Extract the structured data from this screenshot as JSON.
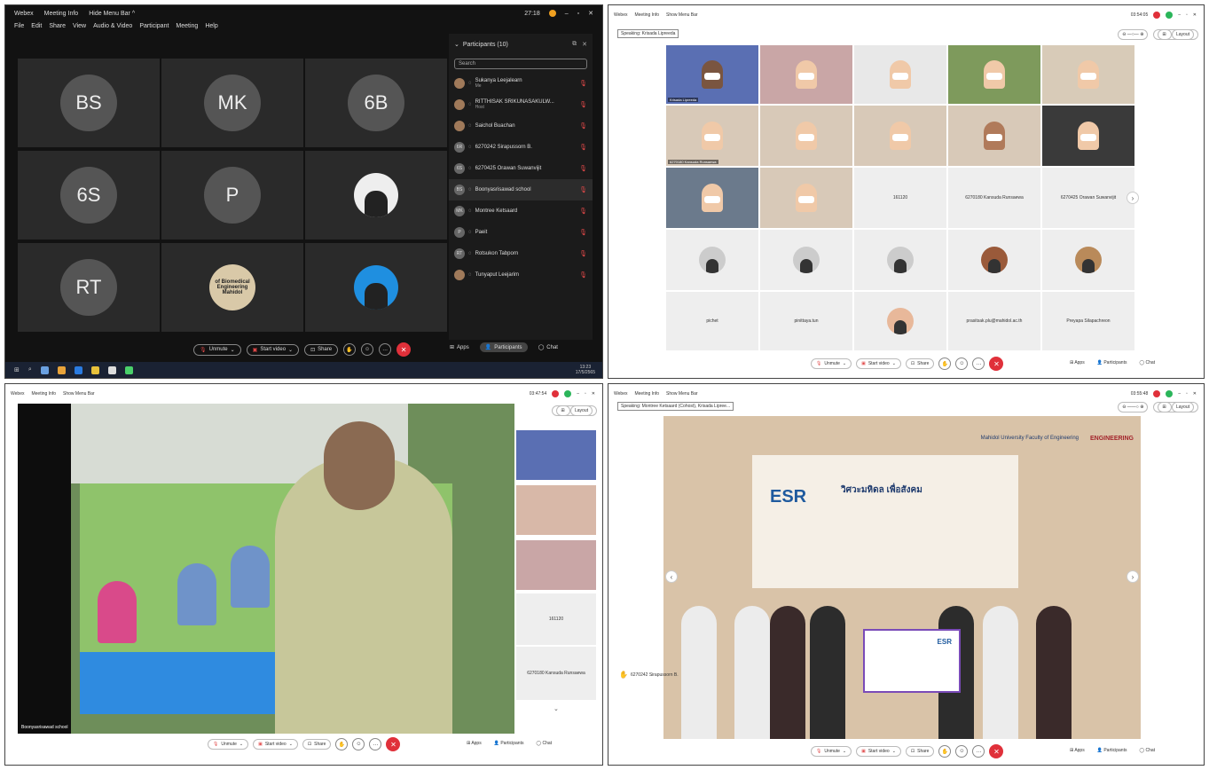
{
  "q1": {
    "title": {
      "app": "Webex",
      "meeting_info": "Meeting Info",
      "hide_menu": "Hide Menu Bar ^",
      "time": "27:18"
    },
    "menu": [
      "File",
      "Edit",
      "Share",
      "View",
      "Audio & Video",
      "Participant",
      "Meeting",
      "Help"
    ],
    "tiles": [
      "BS",
      "MK",
      "6B",
      "6S",
      "P",
      "RT"
    ],
    "logo_text": "of Biomedical Engineering Mahidol",
    "panel": {
      "title": "Participants (10)",
      "search_placeholder": "Search",
      "participants": [
        {
          "name": "Sukanya Leejalearn",
          "sub": "Me",
          "initials": ""
        },
        {
          "name": "RITTHISAK SRIKUNASAKULW...",
          "sub": "Host",
          "initials": ""
        },
        {
          "name": "Saichol Buachan",
          "sub": "",
          "initials": ""
        },
        {
          "name": "6270242 Sirapussorn B.",
          "sub": "",
          "initials": "6R"
        },
        {
          "name": "6270425 Orawan Suwanvijit",
          "sub": "",
          "initials": "6S"
        },
        {
          "name": "Boonyasrisawad school",
          "sub": "",
          "initials": "BS"
        },
        {
          "name": "Montree Ketsaard",
          "sub": "",
          "initials": "MK"
        },
        {
          "name": "Paeit",
          "sub": "",
          "initials": "P"
        },
        {
          "name": "Rotsukon Tabporn",
          "sub": "",
          "initials": "RT"
        },
        {
          "name": "Tunyaput Leejarim",
          "sub": "",
          "initials": ""
        }
      ]
    },
    "controls": {
      "unmute": "Unmute",
      "start_video": "Start video",
      "share": "Share",
      "apps": "Apps",
      "participants": "Participants",
      "chat": "Chat"
    },
    "taskbar": {
      "time": "13:23",
      "date": "17/5/2565"
    }
  },
  "q2": {
    "title": {
      "app": "Webex",
      "meeting_info": "Meeting Info",
      "show_menu": "Show Menu Bar",
      "time": "03:54:05"
    },
    "speaking": "Speaking: Krisada Lipreeda",
    "layout": "Layout",
    "grid_names": [
      "161120",
      "6270180 Kansuda Runsaewa",
      "6270425 Orawan Suwanvijit",
      "pichet",
      "pinittaya.tun",
      "prasitsak.plu@mahidol.ac.th",
      "Preyapa Silapachreon"
    ],
    "video_tags": [
      "Krisada Lipreeda",
      "6270180 Kansuda Runsaewa"
    ],
    "controls": {
      "unmute": "Unmute",
      "start_video": "Start video",
      "share": "Share",
      "apps": "Apps",
      "participants": "Participants",
      "chat": "Chat"
    }
  },
  "q3": {
    "title": {
      "app": "Webex",
      "meeting_info": "Meeting Info",
      "show_menu": "Show Menu Bar",
      "time": "03:47:54"
    },
    "layout": "Layout",
    "main_label": "Boonyasrisawad school",
    "side": [
      "161120",
      "6270180 Kansuda Runsaewa"
    ],
    "controls": {
      "unmute": "Unmute",
      "start_video": "Start video",
      "share": "Share",
      "apps": "Apps",
      "participants": "Participants",
      "chat": "Chat"
    }
  },
  "q4": {
    "title": {
      "app": "Webex",
      "meeting_info": "Meeting Info",
      "show_menu": "Show Menu Bar",
      "time": "03:55:48"
    },
    "speaking": "Speaking: Montree Ketsaard (Cohost), Krisada Lipree...",
    "layout": "Layout",
    "share_text": {
      "esr": "ESR",
      "thai": "วิศวะมหิดล เพื่อสังคม",
      "univ": "Mahidol University Faculty of Engineering",
      "eng": "ENGINEERING"
    },
    "hand_label": "6270242 Sirapussorn B.",
    "controls": {
      "unmute": "Unmute",
      "start_video": "Start video",
      "share": "Share",
      "apps": "Apps",
      "participants": "Participants",
      "chat": "Chat"
    }
  }
}
